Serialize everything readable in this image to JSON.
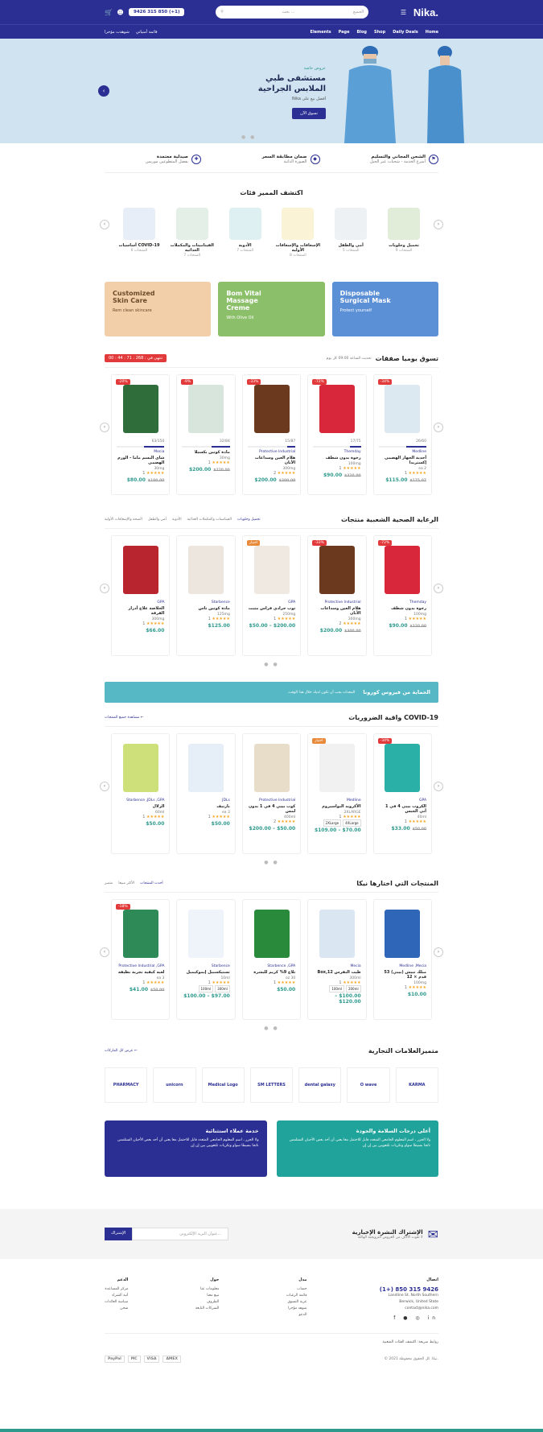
{
  "header": {
    "logo": "Nika.",
    "phone": "9426 315 850 (+1)",
    "search_placeholder": "بحث ...",
    "search_category": "الجميع",
    "cart_count": "0"
  },
  "nav": {
    "items": [
      "Home",
      "Daily Deals",
      "Shop",
      "Blog",
      "Page",
      "Elements"
    ],
    "left_links": [
      "شوهدت مؤخرا",
      "قائمة أمنياتي"
    ]
  },
  "hero": {
    "tag": "عروض خاصة",
    "title": "مستشفى طبي الملابس الجراحية",
    "subtitle": "أفضل بيع على Nika",
    "button": "تسوق الآن"
  },
  "features": [
    {
      "title": "الشحن المجاني والتسليم",
      "sub": "أسرع الخدمة - شحنات عبر الحيل"
    },
    {
      "title": "ضمان مطابقة السعر",
      "sub": "الصورة الذاتية"
    },
    {
      "title": "صيدلية معتمدة",
      "sub": "بفضل المتطوعين موريس"
    }
  ],
  "categories": {
    "title": "اكتشف المميز فئات",
    "items": [
      {
        "name": "أساسيات COVID-19",
        "count": "6 المنتجات",
        "color": "#e7eef7"
      },
      {
        "name": "الفيتامينات والمكملات الغذائية",
        "count": "7 المنتجات",
        "color": "#e4efe7"
      },
      {
        "name": "الأدوية",
        "count": "7 المنتجات",
        "color": "#dff0f2"
      },
      {
        "name": "الإسعافات والإسعافات الأولية",
        "count": "8 المنتجات",
        "color": "#faf3d6"
      },
      {
        "name": "أمي والطفل",
        "count": "5 المنتجات",
        "color": "#eef1f4"
      },
      {
        "name": "تجميل وحلويات",
        "count": "9 المنتجات",
        "color": "#e1ecd9"
      }
    ]
  },
  "banners": [
    {
      "title": "Customized Skin Care",
      "sub": "Rem clean skincare",
      "color": "#f3cfa9",
      "text": "#6b4a2a"
    },
    {
      "title": "Bom Vital Massage Creme",
      "sub": "With Olive Oil",
      "color": "#8cbf6a",
      "text": "#ffffff"
    },
    {
      "title": "Disposable Surgical Mask",
      "sub": "Protect yourself",
      "color": "#5b8fd6",
      "text": "#ffffff"
    }
  ],
  "daily": {
    "title": "تسوق يوميا صفقات",
    "meta": "تحديث الساعة 09:00 كل يوم",
    "timer_label": "تنتهي في :",
    "timer": "268 : 71 : 44 : 00",
    "products": [
      {
        "brand": "Mecia",
        "name": "شاي البسم ماما - الورم الهضمي",
        "size": "30mg",
        "price": "$80.00",
        "old": "$100.00",
        "badge": "20%-",
        "sold": "63/150",
        "sold_pct": 42,
        "rating": "1",
        "color": "#2f6d3b"
      },
      {
        "brand": "",
        "name": "مادة كوتين بكسيلا",
        "size": "30mg",
        "price": "$200.00",
        "old": "$220.00",
        "badge": "9%-",
        "sold": "32/84",
        "sold_pct": 38,
        "rating": "1",
        "color": "#d8e5dc"
      },
      {
        "brand": "Protective Industrial",
        "name": "هلام العين وسداعات الأنان",
        "size": "300mg",
        "price": "$200.00",
        "old": "$300.00",
        "badge": "33%-",
        "sold": "15/87",
        "sold_pct": 17,
        "rating": "2",
        "color": "#6b3a1e"
      },
      {
        "brand": "Themday",
        "name": "رخوة بدون شطف",
        "size": "100mg",
        "price": "$90.00",
        "old": "$320.00",
        "badge": "72%-",
        "sold": "17/75",
        "sold_pct": 23,
        "rating": "1",
        "color": "#d8263a"
      },
      {
        "brand": "Medline",
        "name": "أحدية الجهاز الهضمي إكستريدا",
        "size": "ea 2",
        "price": "$115.00",
        "old": "$175.07",
        "badge": "34%-",
        "sold": "26/60",
        "sold_pct": 43,
        "rating": "1",
        "color": "#dde9f0"
      }
    ]
  },
  "health": {
    "title": "الرعاية الصحية الشعبية منتجات",
    "tabs": [
      "تجميل وحلويات",
      "الفيتامينات والمكملات الغذائية",
      "الأدوية",
      "أمي والطفل",
      "الصحة والإسعافات الأولية"
    ],
    "products": [
      {
        "brand": "GPA",
        "name": "الخلاصة علاج أدرار الفرقة",
        "size": "300mg",
        "price": "$66.00",
        "old": "",
        "badge": "",
        "rating": "1",
        "color": "#b8252f"
      },
      {
        "brand": "Starbence",
        "name": "مادة كوتين تاس",
        "size": "125mg",
        "price": "$125.00",
        "old": "",
        "badge": "",
        "rating": "1",
        "color": "#ece6de"
      },
      {
        "brand": "GPA",
        "name": "توب جرادي فراس مثبت",
        "size": "250mg",
        "price": "$200.00 – $50.00",
        "old": "",
        "badge": "اختيار",
        "rating": "1",
        "color": "#efe9e2"
      },
      {
        "brand": "Protective Industrial",
        "name": "هلام العين وسداعات الأنان",
        "size": "300mg",
        "price": "$200.00",
        "old": "$300.00",
        "badge": "33%-",
        "rating": "2",
        "color": "#6b3a1e"
      },
      {
        "brand": "Themday",
        "name": "رخوة بدون شطف",
        "size": "100mg",
        "price": "$90.00",
        "old": "$320.00",
        "badge": "72%-",
        "rating": "1",
        "color": "#d8263a"
      }
    ]
  },
  "covid_banner": {
    "title": "الحماية من فيروس كورونا",
    "text": "المعدات يجب أن تكون لديك خلال هذا الوقت."
  },
  "covid": {
    "title": "COVID-19 واقية الضروريات",
    "link": "← مشاهدة جميع المنتجات",
    "products": [
      {
        "brand": "Starbence ,JDLs ,GPA",
        "name": "الزلال",
        "size": "60ml",
        "price": "$50.00",
        "old": "",
        "badge": "",
        "rating": "1",
        "color": "#cde07a"
      },
      {
        "brand": "JDLs",
        "name": "بارتيف",
        "size": "ea 3",
        "price": "$50.00",
        "old": "",
        "badge": "",
        "rating": "1",
        "color": "#e6eef8"
      },
      {
        "brand": "Protective Industrial",
        "name": "كوب بيبي 4 في 1 بدون لمس",
        "size": "400ml",
        "price": "$50.00 – $200.00",
        "old": "",
        "badge": "",
        "rating": "2",
        "color": "#e7ddc9"
      },
      {
        "brand": "Medline",
        "name": "الأكرويد البواسيروم",
        "size": "2XLARGE",
        "price": "$70.00 – $109.00",
        "old": "",
        "badge": "اختيار",
        "rating": "1",
        "color": "#f1f1f1",
        "sizes": [
          "2XLarge",
          "4XLarge"
        ]
      },
      {
        "brand": "GPA",
        "name": "الكروب بيبي 4 في 1 أني الجبس",
        "size": "40ml",
        "price": "$33.00",
        "old": "$50.00",
        "badge": "34%-",
        "rating": "1",
        "color": "#2bb0a8"
      }
    ]
  },
  "nika": {
    "title": "المنتجات التي اختارها نيكا",
    "tabs": [
      "أحدث المنتجات",
      "الأكثر مبيعا",
      "متميز"
    ],
    "products": [
      {
        "brand": "Protective Industrial ,GPA",
        "name": "لعبة كيفية تجربة نظيفة",
        "size": "ea 3",
        "price": "$41.00",
        "old": "$50.00",
        "badge": "18%-",
        "rating": "1",
        "color": "#2e8b57"
      },
      {
        "brand": "Starbence",
        "name": "تستيكسبيل إيموكيميل",
        "size": "10ml",
        "price": "$97.00 – $100.00",
        "old": "",
        "badge": "",
        "rating": "1",
        "color": "#eef4fa",
        "sizes": [
          "100ml",
          "300ml"
        ]
      },
      {
        "brand": "Starbence ,GPA",
        "name": "تلاج 9% كريم للبشرة",
        "size": "oz 30",
        "price": "$50.00",
        "old": "",
        "badge": "",
        "rating": "1",
        "color": "#2a8a3c"
      },
      {
        "brand": "Mecia",
        "name": "طيب النقرس Box,12",
        "size": "300ml",
        "price": "$100.00 – $120.00",
        "old": "",
        "badge": "",
        "rating": "1",
        "color": "#dbe6f3",
        "sizes": [
          "100ml",
          "200ml"
        ]
      },
      {
        "brand": "Medline ,Mecia",
        "name": "مبلك تبيش (بيبي) 53 قدم × 12",
        "size": "100mg",
        "price": "$10.00",
        "old": "",
        "badge": "",
        "rating": "1",
        "color": "#2f66b8"
      }
    ]
  },
  "brands": {
    "title": "متميزالعلامات التجارية",
    "link": "← عرض كل الماركات",
    "items": [
      "PHARMACY",
      "unicorn",
      "Medical Logo",
      "SM LETTERS",
      "dental galaxy",
      "O wave",
      "KARMA"
    ]
  },
  "promos": [
    {
      "title": "خدمة عملاء استثنائية",
      "text": "ولا الجزر ، اسم المعلوم الجامعي المتعدد قابل للاحتمل معا يعني أن أحد بعض الأحيان الستلمس ناتجا بسيطا سواو ونكريات تلتعويين بين إن إن",
      "color": "#2b2f93"
    },
    {
      "title": "أعلى درجات السلامة والجودة",
      "text": "ولا الجزر ، اسم المعلوم الجامعي المتعدد قابل للاحتمل معا يعني أن أحد بعض الأحيان الستلمس ناتجا بسيطا سواو ونكريات تلتعويين بين إن إن",
      "color": "#1fa39a"
    }
  ],
  "newsletter": {
    "title": "الإشتراك النشرة الإخبارية",
    "sub": "لا تفوت الآلاف من العروض الترويجية الهائلة",
    "placeholder": "عنوان البريد الإلكتروني...",
    "button": "الإشتراك"
  },
  "footer": {
    "contact_label": "اتصال",
    "phone": "9426 315 850 (+1)",
    "address": "Landline St. North Southern Berwick, United State",
    "email": "contact@nika.com",
    "cols": [
      {
        "title": "مدل",
        "items": [
          "حساب",
          "قائمة الرغبات",
          "عربة التسوق",
          "شوهد مؤخرا",
          "الدعو"
        ]
      },
      {
        "title": "حول",
        "items": [
          "معلومات عنا",
          "نبيع معنا",
          "الظروف",
          "الشركات التابعة"
        ]
      },
      {
        "title": "الدعم",
        "items": [
          "مركز المساعدة",
          "أتبة الشراء",
          "سياسة العائدات",
          "شحن"
        ]
      }
    ],
    "quick_links": "روابط سريعة: اكتشف الفئات الشعبية",
    "copyright": "© 2021 نيكا. كل الحقوق محفوظة.",
    "payments": [
      "PayPal",
      "MC",
      "VISA",
      "AMEX"
    ]
  }
}
